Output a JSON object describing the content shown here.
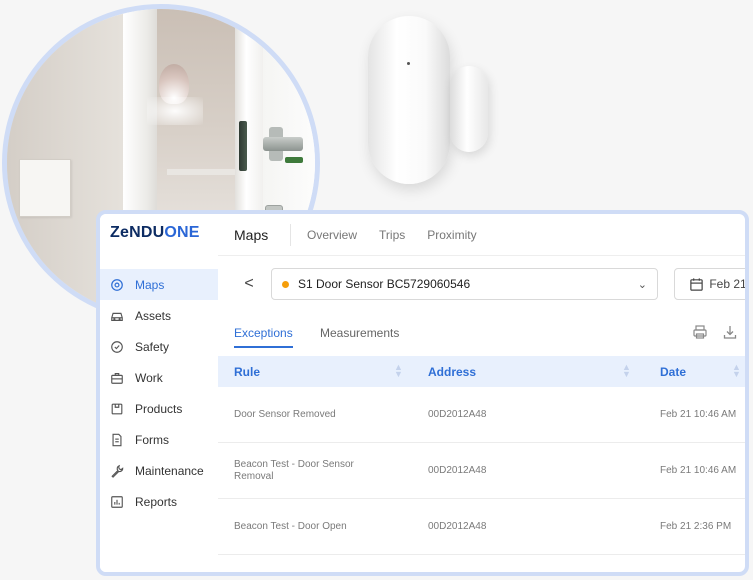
{
  "brand": {
    "logo_part1": "ZeNDU",
    "logo_part2": "ONE"
  },
  "sidebar": {
    "items": [
      {
        "label": "Maps",
        "icon": "map-pin-icon",
        "active": true
      },
      {
        "label": "Assets",
        "icon": "car-icon",
        "active": false
      },
      {
        "label": "Safety",
        "icon": "shield-icon",
        "active": false
      },
      {
        "label": "Work",
        "icon": "briefcase-icon",
        "active": false
      },
      {
        "label": "Products",
        "icon": "product-box-icon",
        "active": false
      },
      {
        "label": "Forms",
        "icon": "document-icon",
        "active": false
      },
      {
        "label": "Maintenance",
        "icon": "wrench-icon",
        "active": false
      },
      {
        "label": "Reports",
        "icon": "report-chart-icon",
        "active": false
      }
    ]
  },
  "header": {
    "title": "Maps",
    "tabs": [
      {
        "label": "Overview"
      },
      {
        "label": "Trips"
      },
      {
        "label": "Proximity"
      }
    ]
  },
  "device": {
    "back_label": "<",
    "selected": "S1 Door Sensor BC5729060546",
    "status_color": "#f59e0b",
    "date": "Feb 21"
  },
  "subtabs": [
    {
      "label": "Exceptions",
      "active": true
    },
    {
      "label": "Measurements",
      "active": false
    }
  ],
  "table": {
    "columns": [
      {
        "label": "Rule"
      },
      {
        "label": "Address"
      },
      {
        "label": "Date"
      }
    ],
    "rows": [
      {
        "rule": "Door Sensor Removed",
        "address": "00D2012A48",
        "date": "Feb 21 10:46 AM"
      },
      {
        "rule": "Beacon Test - Door Sensor Removal",
        "address": "00D2012A48",
        "date": "Feb 21 10:46 AM"
      },
      {
        "rule": "Beacon Test - Door Open",
        "address": "00D2012A48",
        "date": "Feb 21 2:36 PM"
      }
    ]
  },
  "colors": {
    "accent": "#2f6fd6",
    "brand_dark": "#0d2c63",
    "frame": "#cfdcf6",
    "header_bg": "#e8f0fd"
  }
}
